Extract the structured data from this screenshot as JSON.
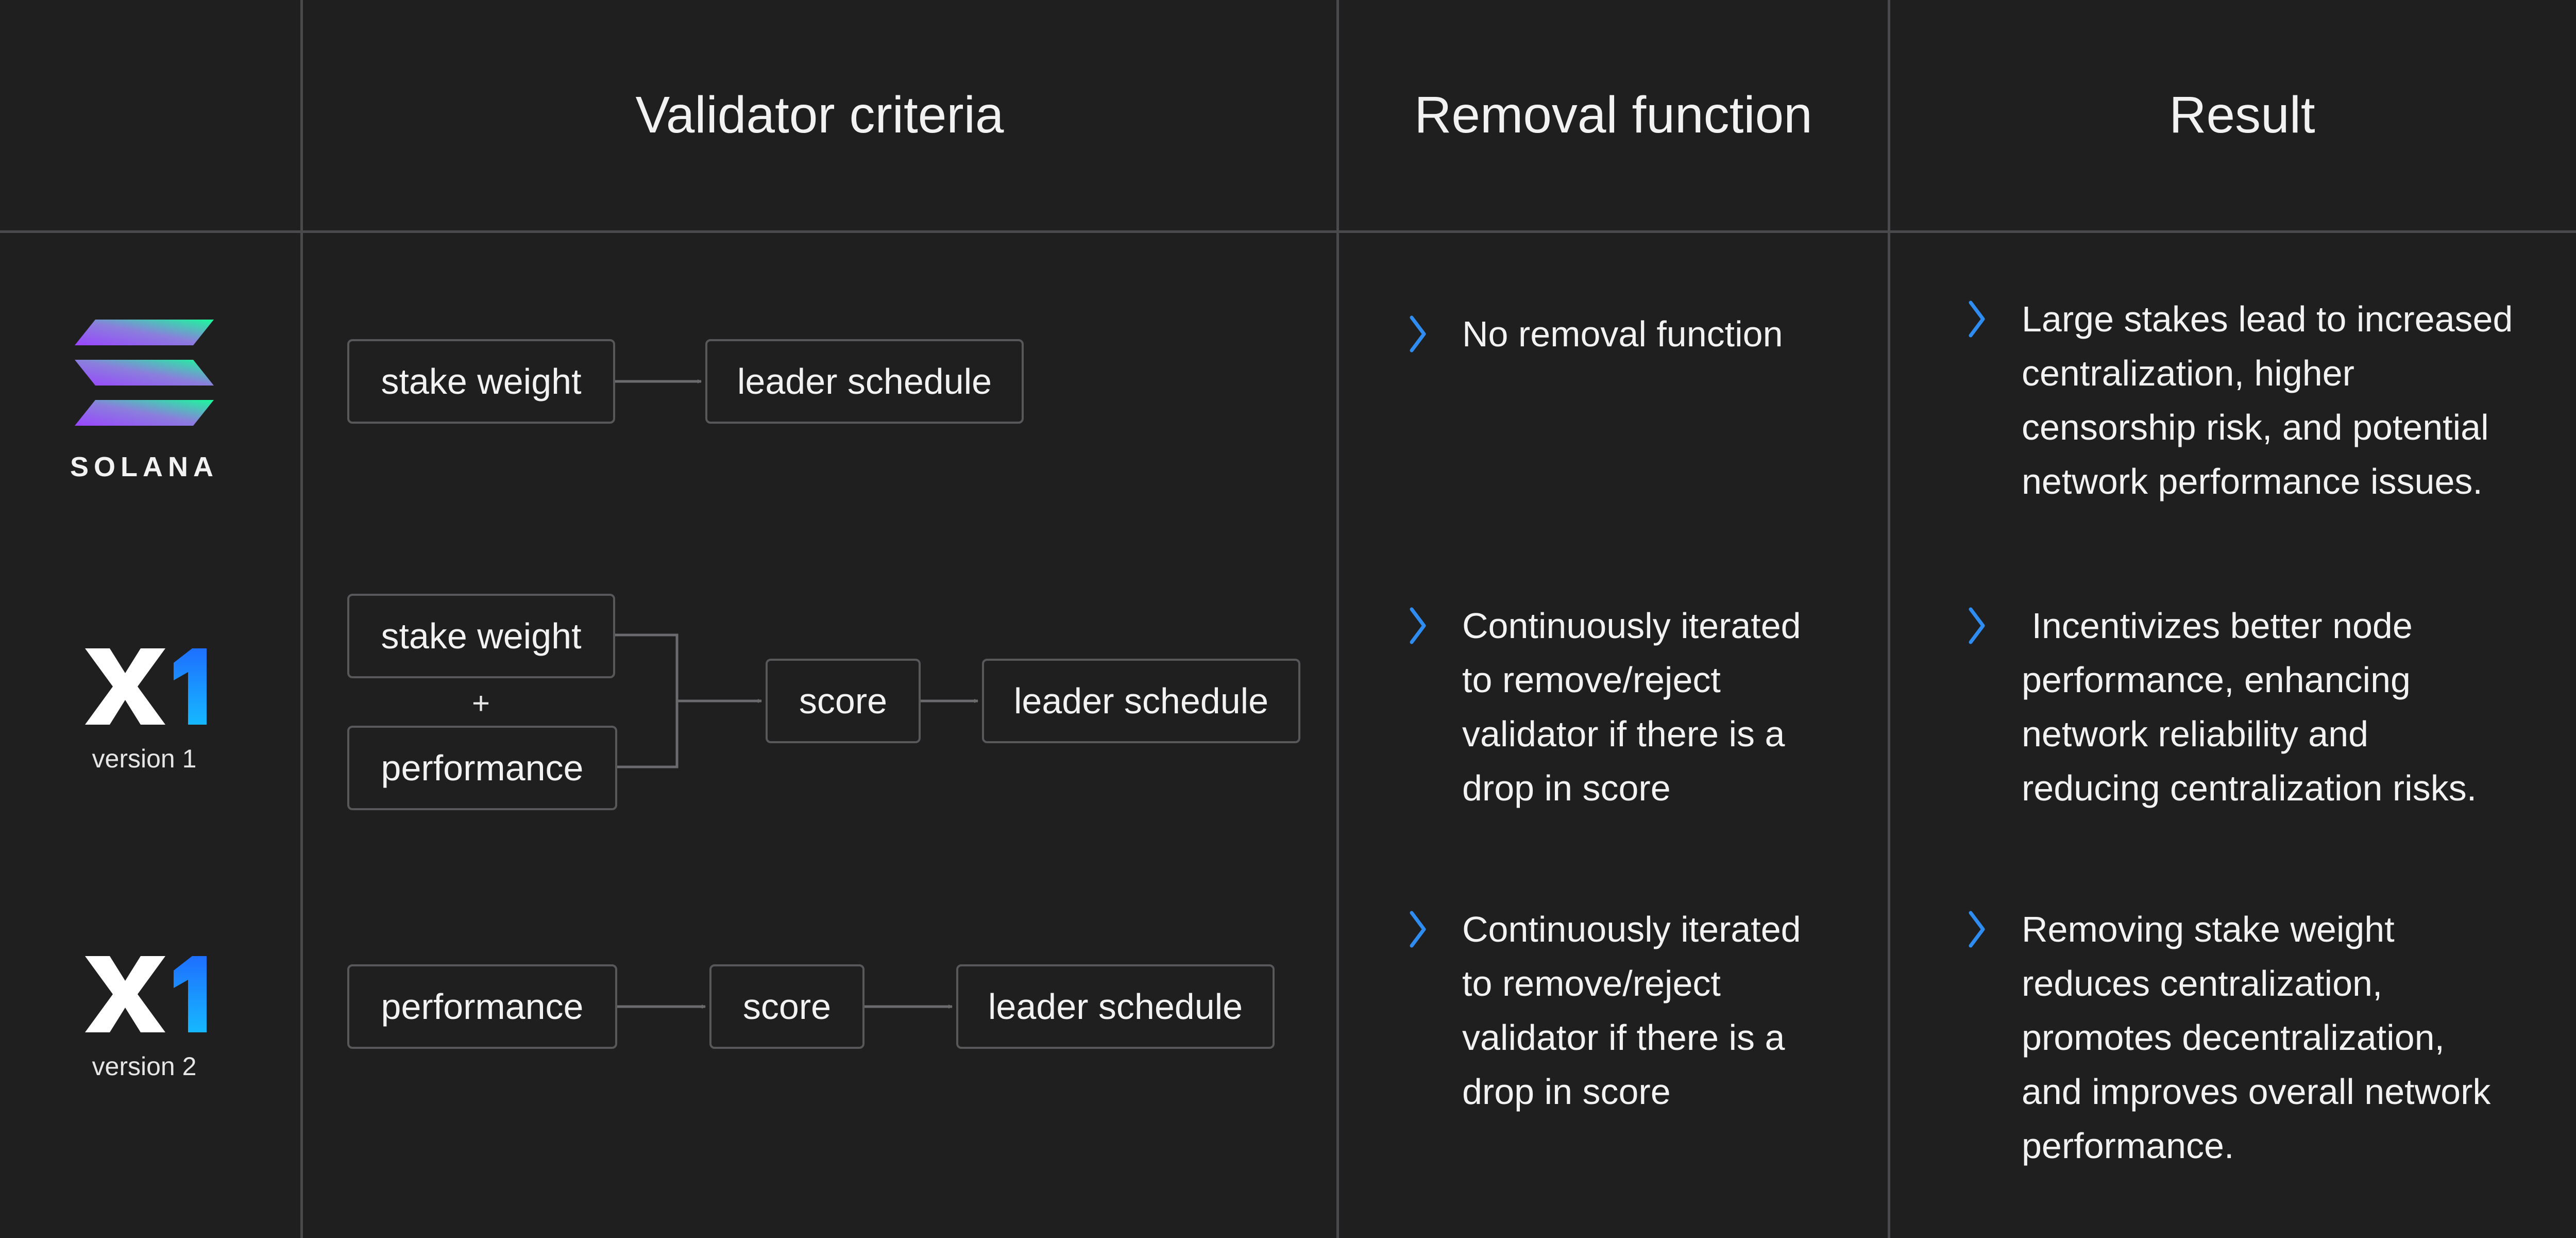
{
  "headers": {
    "validator_criteria": "Validator criteria",
    "removal_function": "Removal function",
    "result": "Result"
  },
  "rows": [
    {
      "logo": {
        "name": "solana-logo",
        "text": "SOLANA"
      },
      "criteria": {
        "stake_weight": "stake weight",
        "leader_schedule": "leader schedule"
      },
      "removal": "No removal function",
      "result": "Large stakes lead to increased\ncentralization, higher\ncensorship risk, and potential\nnetwork performance issues."
    },
    {
      "logo": {
        "name": "x1-logo",
        "text": "X1",
        "version": "version 1"
      },
      "criteria": {
        "stake_weight": "stake weight",
        "plus": "+",
        "performance": "performance",
        "score": "score",
        "leader_schedule": "leader schedule"
      },
      "removal": "Continuously iterated\nto remove/reject\nvalidator if there is a\ndrop in score",
      "result": " Incentivizes better node\nperformance, enhancing\nnetwork reliability and\nreducing centralization risks."
    },
    {
      "logo": {
        "name": "x1-logo",
        "text": "X1",
        "version": "version 2"
      },
      "criteria": {
        "performance": "performance",
        "score": "score",
        "leader_schedule": "leader schedule"
      },
      "removal": "Continuously iterated\nto remove/reject\nvalidator if there is a\ndrop in score",
      "result": "Removing stake weight\nreduces centralization,\npromotes decentralization,\nand improves overall network\nperformance."
    }
  ],
  "colors": {
    "background": "#1f1f20",
    "grid": "#4a4a4c",
    "box_border": "#58585b",
    "bullet": "#2f8cf0",
    "x1_accent": "#1e90ff"
  },
  "icons": {
    "bullet": "chevron-right-icon"
  }
}
